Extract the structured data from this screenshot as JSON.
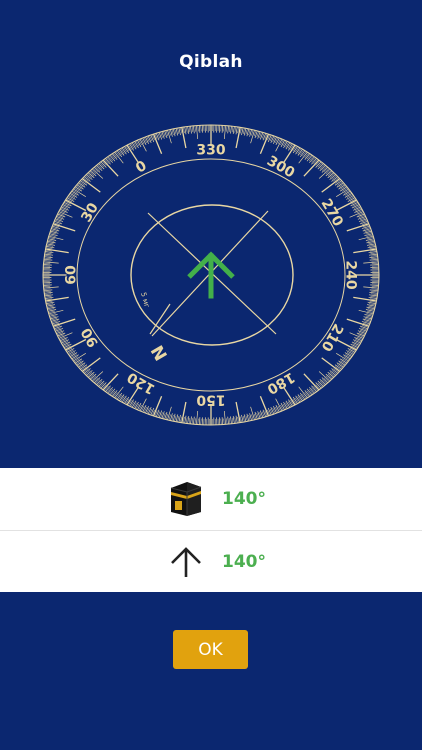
{
  "header": {
    "title": "Qiblah"
  },
  "compass": {
    "degree_labels": [
      "0",
      "30",
      "60",
      "90",
      "120",
      "150",
      "180",
      "210",
      "240",
      "270",
      "300",
      "330"
    ],
    "north_label": "N",
    "center_small_text": "5 мг",
    "ring_color": "#e9d7a3",
    "arrow_color": "#43b04a"
  },
  "info": {
    "kaaba_heading": "140°",
    "arrow_heading": "140°",
    "kaaba_icon": "kaaba-icon",
    "arrow_icon": "arrow-up-icon"
  },
  "actions": {
    "ok_label": "OK"
  },
  "colors": {
    "background": "#0b2770",
    "accent_green": "#4caf50",
    "button": "#e1a20e",
    "ring": "#e9d7a3"
  }
}
